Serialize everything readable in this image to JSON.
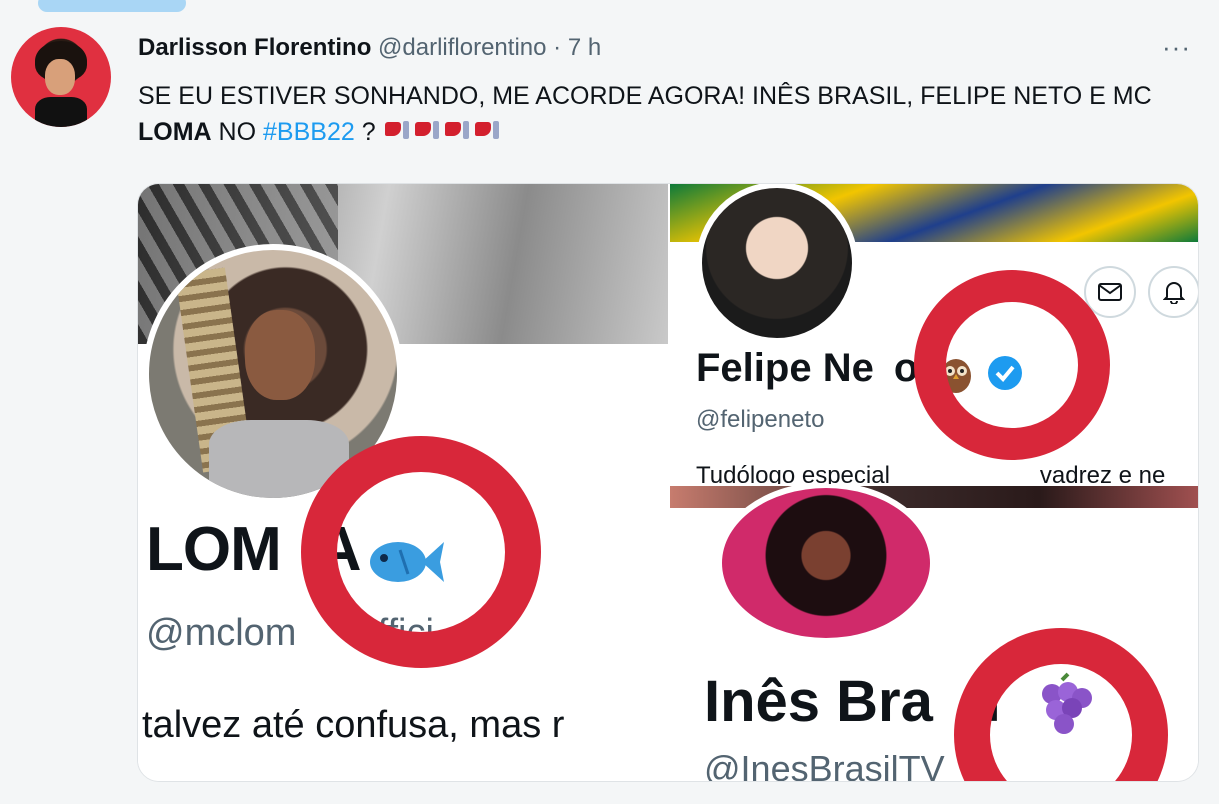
{
  "tweet": {
    "author_name": "Darlisson Florentino",
    "author_handle": "@darliflorentino",
    "separator": "·",
    "time": "7 h",
    "more": "···",
    "text_part1": "SE EU ESTIVER SONHANDO, ME ACORDE AGORA! INÊS BRASIL, FELIPE NETO E MC ",
    "text_bold": "LOMA",
    "text_part2": " NO ",
    "hashtag": "#BBB22",
    "text_part3": " ?",
    "emoji_name": "thumbs-down-emoji",
    "emoji_count": 4
  },
  "media": {
    "loma": {
      "name": "LOM",
      "name_tail": "A",
      "handle": "@mclom",
      "handle_tail": "offici",
      "bio": "talvez até confusa, mas r",
      "badge_icon": "fish-icon"
    },
    "felipe": {
      "name": "Felipe Ne",
      "name_tail": "o",
      "handle": "@felipeneto",
      "bio": "Tudólogo especial",
      "bio_tail": "vadrez e ne",
      "badge_icon": "owl-icon",
      "verified_icon": "verified-badge-icon",
      "action_icons": [
        "mail-icon",
        "bell-icon"
      ]
    },
    "ines": {
      "name": "Inês Bra",
      "name_tail": "l",
      "handle": "@InesBrasilTV",
      "badge_icon": "grapes-icon"
    }
  },
  "colors": {
    "highlight_ring": "#d8273a",
    "link": "#1d9bf0",
    "secondary_text": "#536471",
    "verified": "#1d9bf0"
  }
}
